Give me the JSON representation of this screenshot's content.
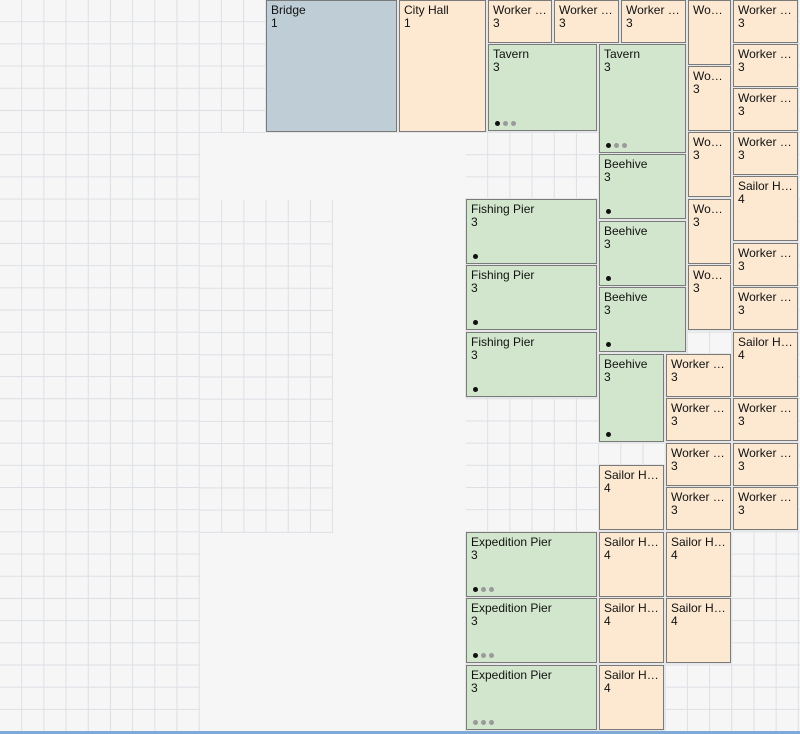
{
  "tiles": [
    {
      "name": "Bridge",
      "value": "1",
      "kind": "bridge"
    },
    {
      "name": "City Hall",
      "value": "1",
      "kind": "worker"
    },
    {
      "name": "Worker House",
      "value": "3",
      "kind": "worker"
    },
    {
      "name": "Worker House",
      "value": "3",
      "kind": "worker"
    },
    {
      "name": "Worker House",
      "value": "3",
      "kind": "worker"
    },
    {
      "name": "Worker House",
      "value": "",
      "kind": "worker"
    },
    {
      "name": "Worker House",
      "value": "3",
      "kind": "worker"
    },
    {
      "name": "Tavern",
      "value": "3",
      "kind": "green",
      "dots": [
        1,
        0,
        0
      ]
    },
    {
      "name": "Tavern",
      "value": "3",
      "kind": "green",
      "dots": [
        1,
        0,
        0
      ]
    },
    {
      "name": "Worker House",
      "value": "3",
      "kind": "worker"
    },
    {
      "name": "Worker House",
      "value": "3",
      "kind": "worker"
    },
    {
      "name": "Worker House",
      "value": "3",
      "kind": "worker"
    },
    {
      "name": "Worker House",
      "value": "3",
      "kind": "worker"
    },
    {
      "name": "Worker House",
      "value": "3",
      "kind": "worker"
    },
    {
      "name": "Beehive",
      "value": "3",
      "kind": "green",
      "dots": [
        1
      ]
    },
    {
      "name": "Sailor House",
      "value": "4",
      "kind": "worker"
    },
    {
      "name": "Fishing Pier",
      "value": "3",
      "kind": "green",
      "dots": [
        1
      ]
    },
    {
      "name": "Worker House",
      "value": "3",
      "kind": "worker"
    },
    {
      "name": "Beehive",
      "value": "3",
      "kind": "green",
      "dots": [
        1
      ]
    },
    {
      "name": "Worker House",
      "value": "3",
      "kind": "worker"
    },
    {
      "name": "Fishing Pier",
      "value": "3",
      "kind": "green",
      "dots": [
        1
      ]
    },
    {
      "name": "Worker House",
      "value": "3",
      "kind": "worker"
    },
    {
      "name": "Beehive",
      "value": "3",
      "kind": "green",
      "dots": [
        1
      ]
    },
    {
      "name": "Worker House",
      "value": "3",
      "kind": "worker"
    },
    {
      "name": "Fishing Pier",
      "value": "3",
      "kind": "green",
      "dots": [
        1
      ]
    },
    {
      "name": "Beehive",
      "value": "3",
      "kind": "green",
      "dots": [
        1
      ]
    },
    {
      "name": "Worker House",
      "value": "3",
      "kind": "worker"
    },
    {
      "name": "Sailor House",
      "value": "4",
      "kind": "worker"
    },
    {
      "name": "Worker House",
      "value": "3",
      "kind": "worker"
    },
    {
      "name": "Worker House",
      "value": "3",
      "kind": "worker"
    },
    {
      "name": "Worker House",
      "value": "3",
      "kind": "worker"
    },
    {
      "name": "Worker House",
      "value": "3",
      "kind": "worker"
    },
    {
      "name": "Sailor House",
      "value": "4",
      "kind": "worker"
    },
    {
      "name": "Worker House",
      "value": "3",
      "kind": "worker"
    },
    {
      "name": "Worker House",
      "value": "3",
      "kind": "worker"
    },
    {
      "name": "Expedition Pier",
      "value": "3",
      "kind": "green",
      "dots": [
        1,
        0,
        0
      ]
    },
    {
      "name": "Sailor House",
      "value": "4",
      "kind": "worker"
    },
    {
      "name": "Sailor House",
      "value": "4",
      "kind": "worker"
    },
    {
      "name": "Expedition Pier",
      "value": "3",
      "kind": "green",
      "dots": [
        1,
        0,
        0
      ]
    },
    {
      "name": "Sailor House",
      "value": "4",
      "kind": "worker"
    },
    {
      "name": "Sailor House",
      "value": "4",
      "kind": "worker"
    },
    {
      "name": "Expedition Pier",
      "value": "3",
      "kind": "green",
      "dots": [
        0,
        0,
        0
      ]
    },
    {
      "name": "Sailor House",
      "value": "4",
      "kind": "worker"
    }
  ],
  "colors": {
    "worker_fill": "#fde9d2",
    "green_fill": "#d2e6cd",
    "bridge_fill": "#bfcdd6",
    "grid_line": "#dcdfe4",
    "background": "#f6f6f6"
  }
}
